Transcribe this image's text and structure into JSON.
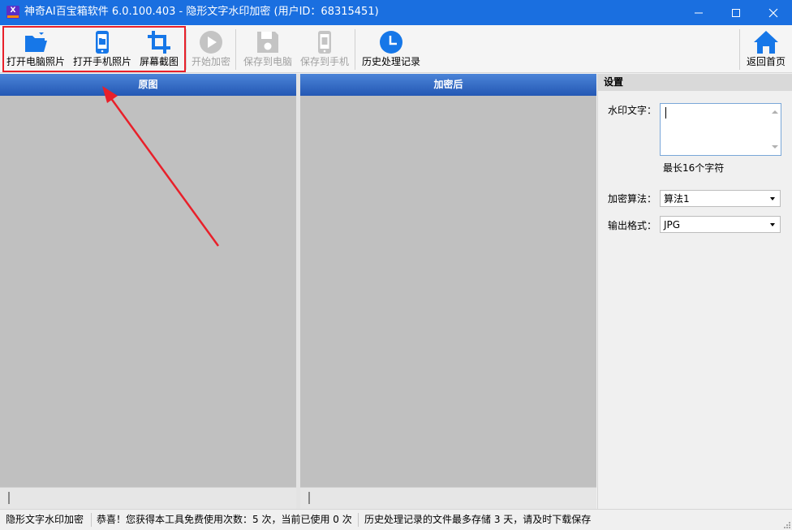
{
  "window": {
    "title": "神奇AI百宝箱软件 6.0.100.403 - 隐形文字水印加密 (用户ID：68315451)",
    "app_icon_text": "X"
  },
  "toolbar": {
    "open_pc_photo": "打开电脑照片",
    "open_phone_photo": "打开手机照片",
    "screenshot": "屏幕截图",
    "start_encrypt": "开始加密",
    "save_to_pc": "保存到电脑",
    "save_to_phone": "保存到手机",
    "history": "历史处理记录",
    "home": "返回首页"
  },
  "panels": {
    "original_title": "原图",
    "encrypted_title": "加密后"
  },
  "settings": {
    "title": "设置",
    "watermark_label": "水印文字：",
    "watermark_value": "",
    "watermark_hint": "最长16个字符",
    "algorithm_label": "加密算法：",
    "algorithm_value": "算法1",
    "format_label": "输出格式：",
    "format_value": "JPG"
  },
  "status": {
    "mode": "隐形文字水印加密",
    "usage": "恭喜！您获得本工具免费使用次数：5 次，当前已使用 0 次",
    "storage": "历史处理记录的文件最多存储 3 天，请及时下载保存"
  },
  "colors": {
    "titlebar": "#1a6fe0",
    "icon_blue": "#1677e8",
    "highlight_red": "#e8202a",
    "panel_header": "#2f65c0"
  }
}
